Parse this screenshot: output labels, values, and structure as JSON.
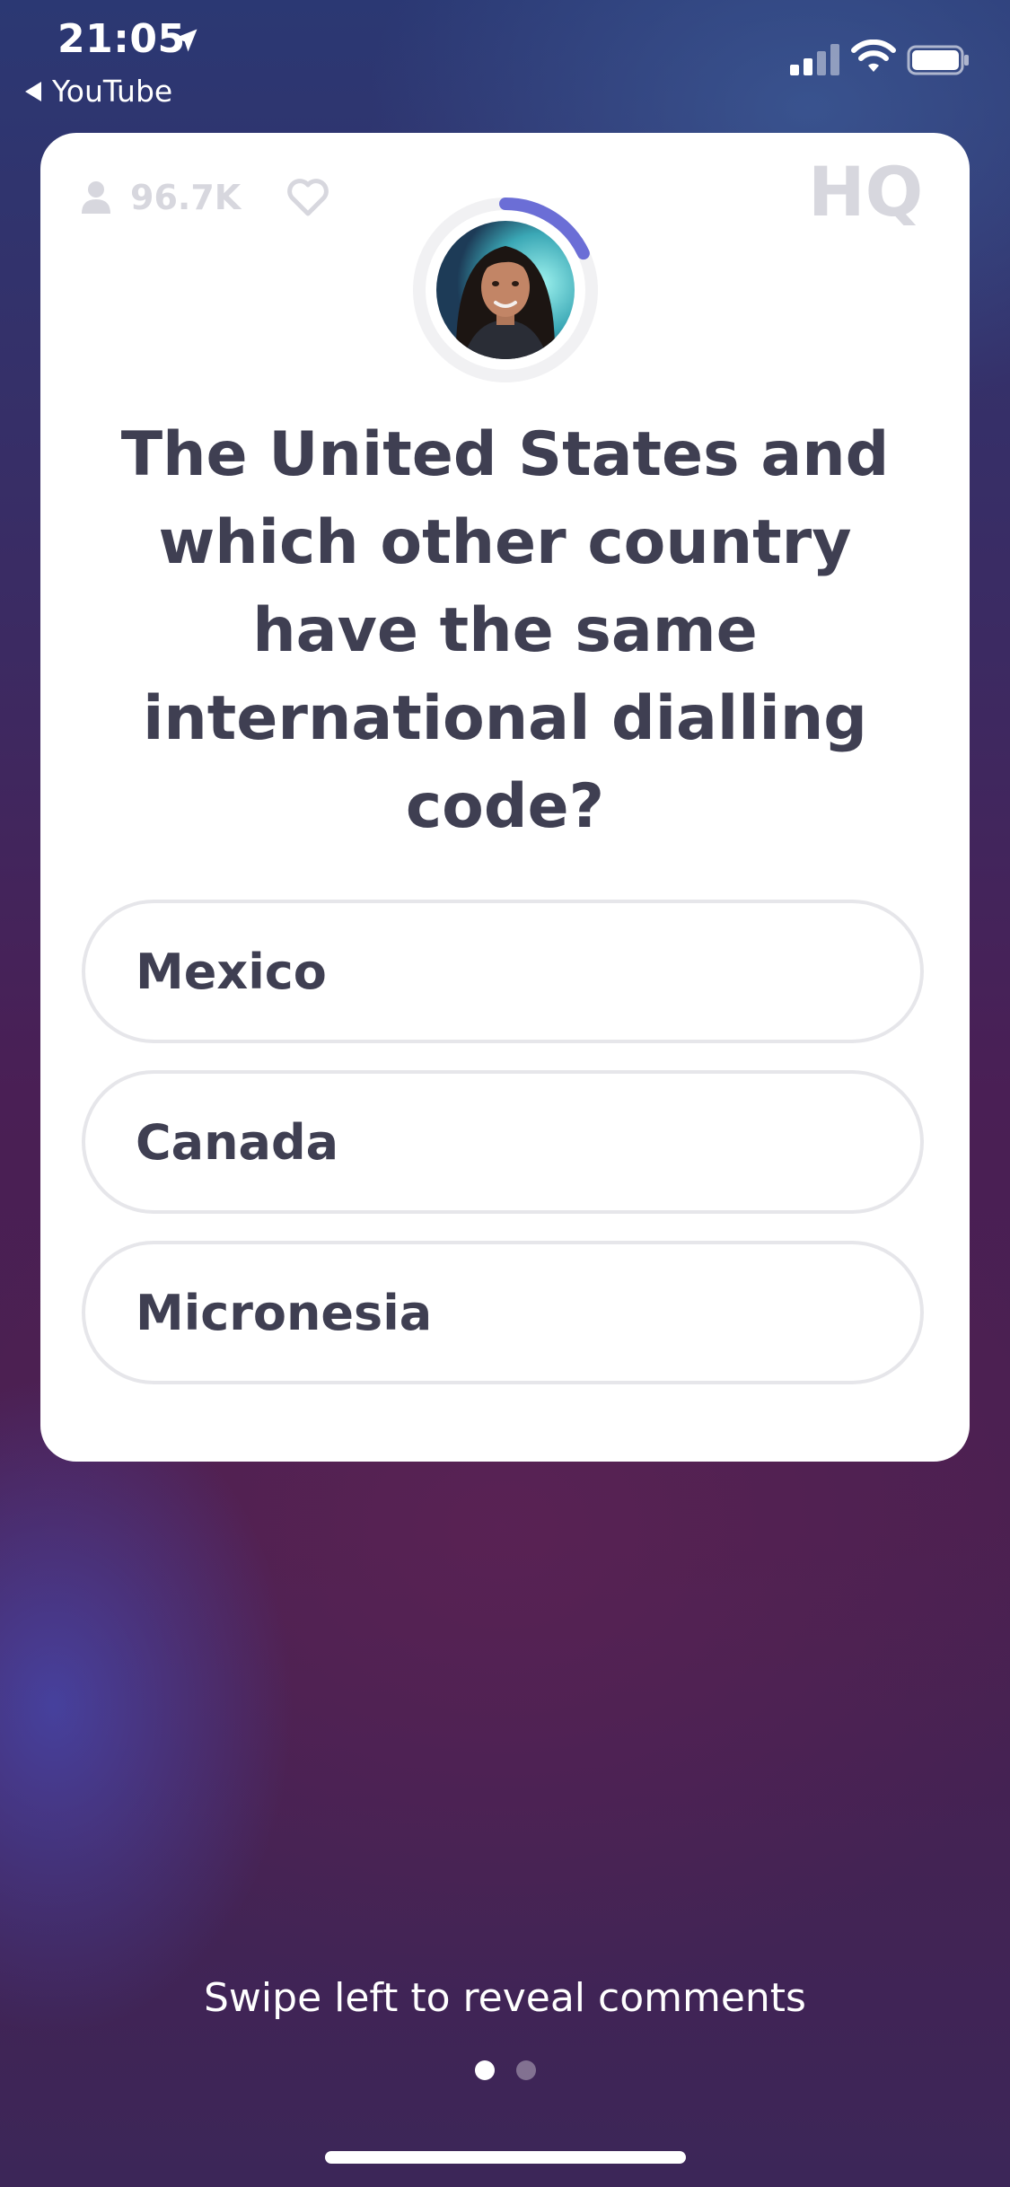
{
  "status_bar": {
    "time": "21:05",
    "back_app": "YouTube",
    "icons": [
      "location-arrow-icon",
      "cellular-signal-icon",
      "wifi-icon",
      "battery-icon"
    ]
  },
  "card": {
    "viewers": "96.7K",
    "logo": "HQ",
    "icons": [
      "person-icon",
      "heart-icon"
    ],
    "question": "The United States and which other country have the same international dialling code?",
    "answers": [
      {
        "label": "Mexico"
      },
      {
        "label": "Canada"
      },
      {
        "label": "Micronesia"
      }
    ],
    "timer_progress": 0.18
  },
  "footer": {
    "hint": "Swipe left to reveal comments",
    "pages": 2,
    "active_page": 1
  },
  "colors": {
    "accent": "#6b6ed6",
    "text_dark": "#3f3f52",
    "muted": "#d7d7de",
    "answer_border": "#e6e6ea",
    "card": "#ffffff"
  }
}
